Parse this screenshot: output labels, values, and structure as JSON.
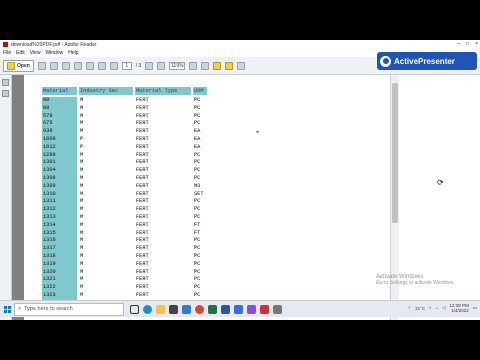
{
  "window": {
    "title": "download%20PDF.pdf - Adobe Reader",
    "controls": [
      "–",
      "□",
      "×"
    ]
  },
  "menu": [
    "File",
    "Edit",
    "View",
    "Window",
    "Help"
  ],
  "toolbar": {
    "open_label": "Open",
    "page_current": "1",
    "page_total": "/ 3",
    "zoom": "119%"
  },
  "brand": {
    "label": "ActivePresenter"
  },
  "table": {
    "headers": [
      "Material",
      "Industry Sec",
      "Material Type",
      "UOM"
    ],
    "rows": [
      [
        "88",
        "M",
        "FERT",
        "PC"
      ],
      [
        "89",
        "M",
        "FERT",
        "PC"
      ],
      [
        "578",
        "M",
        "FERT",
        "PC"
      ],
      [
        "675",
        "M",
        "FERT",
        "PC"
      ],
      [
        "938",
        "M",
        "FERT",
        "EA"
      ],
      [
        "1009",
        "P",
        "FERT",
        "EA"
      ],
      [
        "1012",
        "P",
        "FERT",
        "EA"
      ],
      [
        "1289",
        "M",
        "FERT",
        "PC"
      ],
      [
        "1301",
        "M",
        "FERT",
        "PC"
      ],
      [
        "1304",
        "M",
        "FERT",
        "PC"
      ],
      [
        "1308",
        "M",
        "FERT",
        "PC"
      ],
      [
        "1309",
        "M",
        "FERT",
        "M3"
      ],
      [
        "1310",
        "M",
        "FERT",
        "SET"
      ],
      [
        "1311",
        "M",
        "FERT",
        "PC"
      ],
      [
        "1312",
        "M",
        "FERT",
        "PC"
      ],
      [
        "1313",
        "M",
        "FERT",
        "PC"
      ],
      [
        "1314",
        "M",
        "FERT",
        "FT"
      ],
      [
        "1315",
        "M",
        "FERT",
        "FT"
      ],
      [
        "1316",
        "M",
        "FERT",
        "PC"
      ],
      [
        "1317",
        "M",
        "FERT",
        "PC"
      ],
      [
        "1318",
        "M",
        "FERT",
        "PC"
      ],
      [
        "1319",
        "M",
        "FERT",
        "PC"
      ],
      [
        "1320",
        "M",
        "FERT",
        "PC"
      ],
      [
        "1321",
        "M",
        "FERT",
        "PC"
      ],
      [
        "1322",
        "M",
        "FERT",
        "PC"
      ],
      [
        "1323",
        "M",
        "FERT",
        "PC"
      ]
    ]
  },
  "watermark": {
    "line1": "Activate Windows",
    "line2": "Go to Settings to activate Windows."
  },
  "taskbar": {
    "search_placeholder": "Type here to search",
    "temperature": "31°C",
    "time": "12:38 PM",
    "date": "1/4/2022"
  },
  "colors": {
    "header_fill": "#7fc8cc",
    "header_text": "#1f3a80",
    "brand_blue": "#1e56b8"
  }
}
